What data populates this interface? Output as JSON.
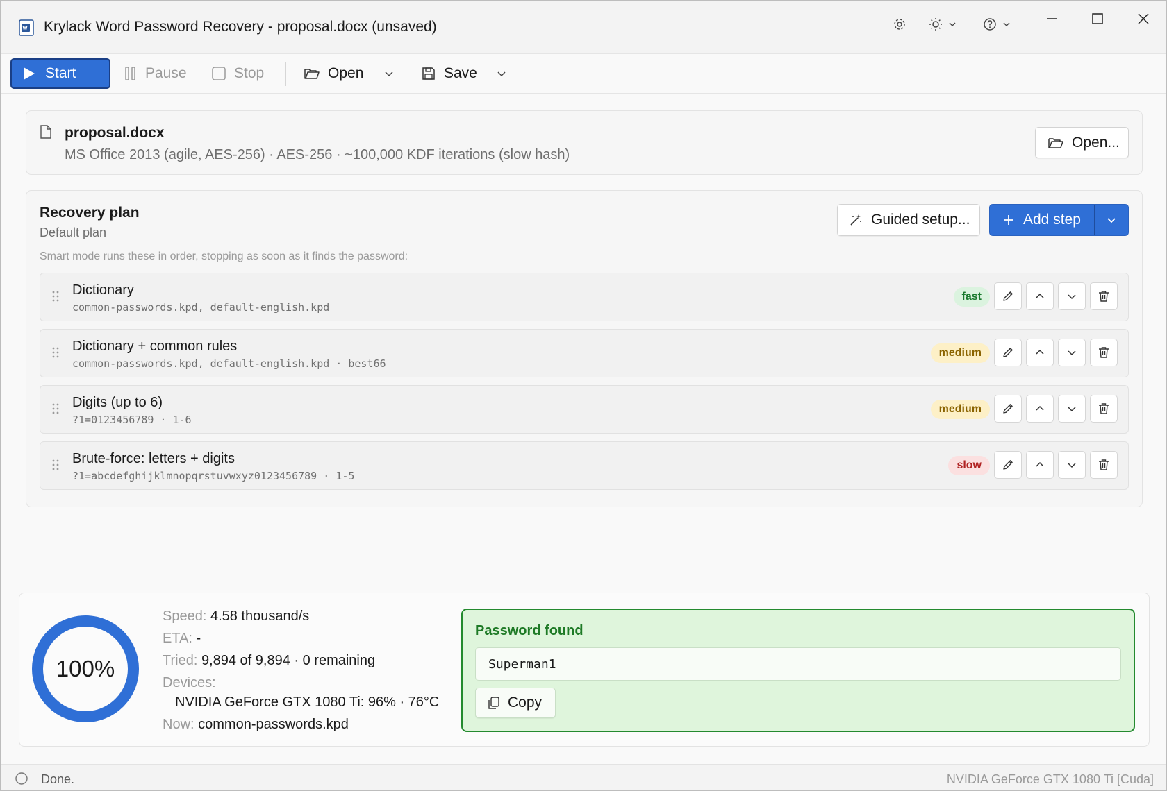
{
  "window": {
    "title": "Krylack Word Password Recovery - proposal.docx (unsaved)"
  },
  "toolbar": {
    "start_label": "Start",
    "pause_label": "Pause",
    "stop_label": "Stop",
    "open_label": "Open",
    "save_label": "Save"
  },
  "file": {
    "name": "proposal.docx",
    "meta": "MS Office 2013 (agile, AES-256) · AES-256 · ~100,000 KDF iterations (slow hash)",
    "open_button": "Open..."
  },
  "plan": {
    "title": "Recovery plan",
    "subtitle": "Default plan",
    "hint": "Smart mode runs these in order, stopping as soon as it finds the password:",
    "guided_button": "Guided setup...",
    "add_step_button": "Add step",
    "steps": [
      {
        "name": "Dictionary",
        "detail": "common-passwords.kpd, default-english.kpd",
        "speed": "fast"
      },
      {
        "name": "Dictionary + common rules",
        "detail": "common-passwords.kpd, default-english.kpd · best66",
        "speed": "medium"
      },
      {
        "name": "Digits (up to 6)",
        "detail": "?1=0123456789 · 1-6",
        "speed": "medium"
      },
      {
        "name": "Brute-force: letters + digits",
        "detail": "?1=abcdefghijklmnopqrstuvwxyz0123456789 · 1-5",
        "speed": "slow"
      }
    ]
  },
  "progress": {
    "percent_label": "100%",
    "percent_value": 100,
    "speed_label": "Speed:",
    "speed_value": "4.58 thousand/s",
    "eta_label": "ETA:",
    "eta_value": "-",
    "tried_label": "Tried:",
    "tried_value": "9,894 of 9,894 · 0 remaining",
    "devices_label": "Devices:",
    "device_value": "NVIDIA GeForce GTX 1080 Ti: 96% · 76°C",
    "now_label": "Now:",
    "now_value": "common-passwords.kpd"
  },
  "result": {
    "title": "Password found",
    "password": "Superman1",
    "copy_button": "Copy"
  },
  "status": {
    "text": "Done.",
    "device": "NVIDIA GeForce GTX 1080 Ti [Cuda]"
  },
  "colors": {
    "accent": "#2f6fd6",
    "success": "#248a2f",
    "success_bg": "#dff5dc"
  }
}
